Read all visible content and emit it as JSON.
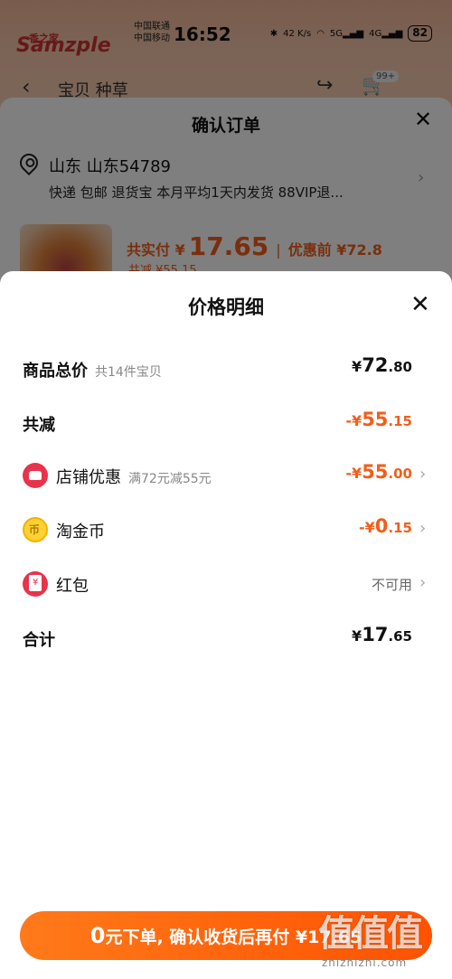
{
  "status_bar": {
    "carrier_1": "中国联通",
    "carrier_2": "中国移动",
    "time": "16:52",
    "speed": "42 K/s",
    "battery": "82"
  },
  "background": {
    "logo_small": "香之家",
    "logo": "Samzple",
    "nav_tabs": "宝贝  种草",
    "cart_badge": "99+",
    "order_sheet": {
      "title": "确认订单",
      "address": "山东 山东54789",
      "address_sub": "快递 包邮 退货宝 本月平均1天内发货 88VIP退...",
      "paid_label": "共实付 ¥",
      "paid_amount": "17.65",
      "before_label": "优惠前 ¥72.8",
      "saving": "共减 ¥55.15"
    }
  },
  "detail": {
    "title": "价格明细",
    "rows": [
      {
        "label": "商品总价",
        "hint": "共14件宝贝",
        "currency": "¥",
        "integer": "72",
        "cents": ".80"
      },
      {
        "label": "共减",
        "currency": "-¥",
        "integer": "55",
        "cents": ".15"
      },
      {
        "label": "店铺优惠",
        "hint": "满72元减55元",
        "currency": "-¥",
        "integer": "55",
        "cents": ".00",
        "icon": "store-icon"
      },
      {
        "label": "淘金币",
        "currency": "-¥",
        "integer": "0",
        "cents": ".15",
        "icon": "gold-coin-icon"
      },
      {
        "label": "红包",
        "status": "不可用",
        "icon": "red-packet-icon"
      },
      {
        "label": "合计",
        "currency": "¥",
        "integer": "17",
        "cents": ".65"
      }
    ]
  },
  "bottom_button": {
    "zero": "0",
    "text": "元下单, 确认收货后再付 ¥17.65"
  },
  "watermark": {
    "glyphs": "值值值",
    "url": "zhizhizhi.com"
  },
  "colors": {
    "accent": "#f25e1a",
    "button_start": "#ff7a1a",
    "button_end": "#ff5200"
  }
}
